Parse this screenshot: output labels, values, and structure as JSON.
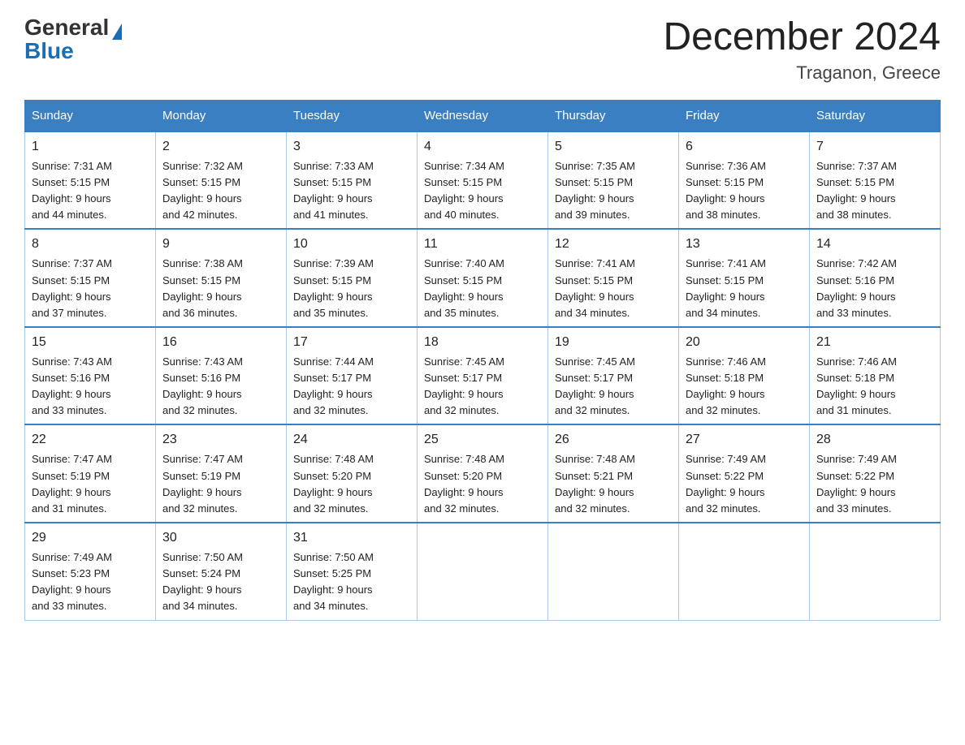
{
  "header": {
    "logo_general": "General",
    "logo_blue": "Blue",
    "month_title": "December 2024",
    "location": "Traganon, Greece"
  },
  "days_of_week": [
    "Sunday",
    "Monday",
    "Tuesday",
    "Wednesday",
    "Thursday",
    "Friday",
    "Saturday"
  ],
  "weeks": [
    [
      {
        "day": "1",
        "sunrise": "7:31 AM",
        "sunset": "5:15 PM",
        "daylight": "9 hours and 44 minutes."
      },
      {
        "day": "2",
        "sunrise": "7:32 AM",
        "sunset": "5:15 PM",
        "daylight": "9 hours and 42 minutes."
      },
      {
        "day": "3",
        "sunrise": "7:33 AM",
        "sunset": "5:15 PM",
        "daylight": "9 hours and 41 minutes."
      },
      {
        "day": "4",
        "sunrise": "7:34 AM",
        "sunset": "5:15 PM",
        "daylight": "9 hours and 40 minutes."
      },
      {
        "day": "5",
        "sunrise": "7:35 AM",
        "sunset": "5:15 PM",
        "daylight": "9 hours and 39 minutes."
      },
      {
        "day": "6",
        "sunrise": "7:36 AM",
        "sunset": "5:15 PM",
        "daylight": "9 hours and 38 minutes."
      },
      {
        "day": "7",
        "sunrise": "7:37 AM",
        "sunset": "5:15 PM",
        "daylight": "9 hours and 38 minutes."
      }
    ],
    [
      {
        "day": "8",
        "sunrise": "7:37 AM",
        "sunset": "5:15 PM",
        "daylight": "9 hours and 37 minutes."
      },
      {
        "day": "9",
        "sunrise": "7:38 AM",
        "sunset": "5:15 PM",
        "daylight": "9 hours and 36 minutes."
      },
      {
        "day": "10",
        "sunrise": "7:39 AM",
        "sunset": "5:15 PM",
        "daylight": "9 hours and 35 minutes."
      },
      {
        "day": "11",
        "sunrise": "7:40 AM",
        "sunset": "5:15 PM",
        "daylight": "9 hours and 35 minutes."
      },
      {
        "day": "12",
        "sunrise": "7:41 AM",
        "sunset": "5:15 PM",
        "daylight": "9 hours and 34 minutes."
      },
      {
        "day": "13",
        "sunrise": "7:41 AM",
        "sunset": "5:15 PM",
        "daylight": "9 hours and 34 minutes."
      },
      {
        "day": "14",
        "sunrise": "7:42 AM",
        "sunset": "5:16 PM",
        "daylight": "9 hours and 33 minutes."
      }
    ],
    [
      {
        "day": "15",
        "sunrise": "7:43 AM",
        "sunset": "5:16 PM",
        "daylight": "9 hours and 33 minutes."
      },
      {
        "day": "16",
        "sunrise": "7:43 AM",
        "sunset": "5:16 PM",
        "daylight": "9 hours and 32 minutes."
      },
      {
        "day": "17",
        "sunrise": "7:44 AM",
        "sunset": "5:17 PM",
        "daylight": "9 hours and 32 minutes."
      },
      {
        "day": "18",
        "sunrise": "7:45 AM",
        "sunset": "5:17 PM",
        "daylight": "9 hours and 32 minutes."
      },
      {
        "day": "19",
        "sunrise": "7:45 AM",
        "sunset": "5:17 PM",
        "daylight": "9 hours and 32 minutes."
      },
      {
        "day": "20",
        "sunrise": "7:46 AM",
        "sunset": "5:18 PM",
        "daylight": "9 hours and 32 minutes."
      },
      {
        "day": "21",
        "sunrise": "7:46 AM",
        "sunset": "5:18 PM",
        "daylight": "9 hours and 31 minutes."
      }
    ],
    [
      {
        "day": "22",
        "sunrise": "7:47 AM",
        "sunset": "5:19 PM",
        "daylight": "9 hours and 31 minutes."
      },
      {
        "day": "23",
        "sunrise": "7:47 AM",
        "sunset": "5:19 PM",
        "daylight": "9 hours and 32 minutes."
      },
      {
        "day": "24",
        "sunrise": "7:48 AM",
        "sunset": "5:20 PM",
        "daylight": "9 hours and 32 minutes."
      },
      {
        "day": "25",
        "sunrise": "7:48 AM",
        "sunset": "5:20 PM",
        "daylight": "9 hours and 32 minutes."
      },
      {
        "day": "26",
        "sunrise": "7:48 AM",
        "sunset": "5:21 PM",
        "daylight": "9 hours and 32 minutes."
      },
      {
        "day": "27",
        "sunrise": "7:49 AM",
        "sunset": "5:22 PM",
        "daylight": "9 hours and 32 minutes."
      },
      {
        "day": "28",
        "sunrise": "7:49 AM",
        "sunset": "5:22 PM",
        "daylight": "9 hours and 33 minutes."
      }
    ],
    [
      {
        "day": "29",
        "sunrise": "7:49 AM",
        "sunset": "5:23 PM",
        "daylight": "9 hours and 33 minutes."
      },
      {
        "day": "30",
        "sunrise": "7:50 AM",
        "sunset": "5:24 PM",
        "daylight": "9 hours and 34 minutes."
      },
      {
        "day": "31",
        "sunrise": "7:50 AM",
        "sunset": "5:25 PM",
        "daylight": "9 hours and 34 minutes."
      },
      null,
      null,
      null,
      null
    ]
  ],
  "labels": {
    "sunrise": "Sunrise:",
    "sunset": "Sunset:",
    "daylight": "Daylight:"
  }
}
